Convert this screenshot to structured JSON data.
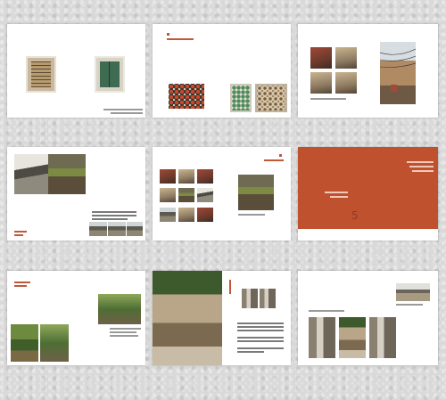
{
  "spread1": {
    "caption_lines": [
      "",
      ""
    ],
    "page_left": "",
    "page_right": ""
  },
  "spread2": {
    "heading": "",
    "icon": "square-mark-icon"
  },
  "spread3": {
    "caption": ""
  },
  "spread4": {
    "label_red": "",
    "label_sub": ""
  },
  "spread5": {
    "heading": ""
  },
  "spread6": {
    "chapter_number": "5",
    "title_lines": [
      "",
      ""
    ],
    "side_lines": [
      "",
      "",
      ""
    ],
    "bg_color": "#c0512e"
  },
  "spread7": {
    "heading_red": "",
    "subheading": ""
  },
  "spread8": {
    "side_heading": ""
  },
  "spread9": {
    "caption": ""
  }
}
